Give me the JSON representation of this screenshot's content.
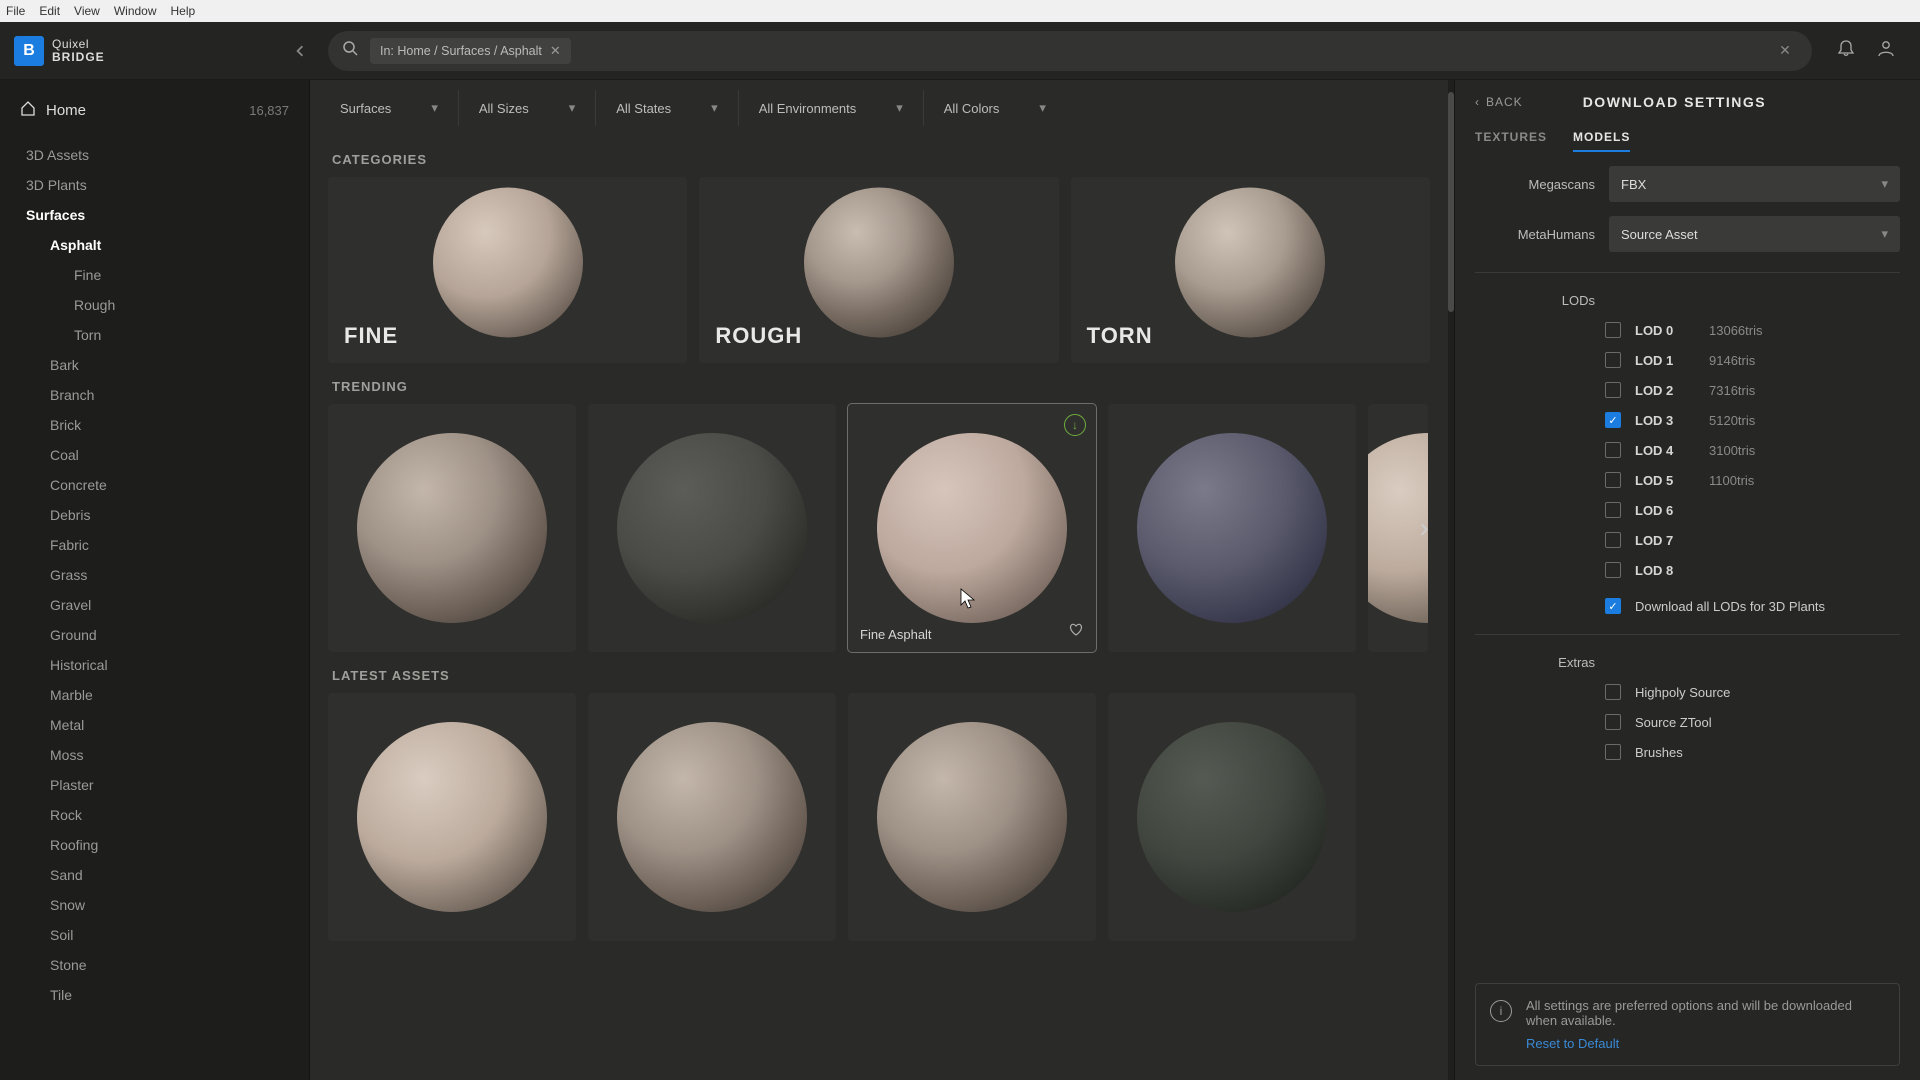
{
  "menubar": [
    "File",
    "Edit",
    "View",
    "Window",
    "Help"
  ],
  "brand": {
    "line1": "Quixel",
    "line2": "BRIDGE"
  },
  "search_chip": "In: Home / Surfaces / Asphalt",
  "home_label": "Home",
  "home_count": "16,837",
  "sidebar": {
    "top": [
      {
        "label": "3D Assets"
      },
      {
        "label": "3D Plants"
      },
      {
        "label": "Surfaces",
        "active": true,
        "children": [
          {
            "label": "Asphalt",
            "active": true,
            "children": [
              {
                "label": "Fine"
              },
              {
                "label": "Rough"
              },
              {
                "label": "Torn"
              }
            ]
          },
          {
            "label": "Bark"
          },
          {
            "label": "Branch"
          },
          {
            "label": "Brick"
          },
          {
            "label": "Coal"
          },
          {
            "label": "Concrete"
          },
          {
            "label": "Debris"
          },
          {
            "label": "Fabric"
          },
          {
            "label": "Grass"
          },
          {
            "label": "Gravel"
          },
          {
            "label": "Ground"
          },
          {
            "label": "Historical"
          },
          {
            "label": "Marble"
          },
          {
            "label": "Metal"
          },
          {
            "label": "Moss"
          },
          {
            "label": "Plaster"
          },
          {
            "label": "Rock"
          },
          {
            "label": "Roofing"
          },
          {
            "label": "Sand"
          },
          {
            "label": "Snow"
          },
          {
            "label": "Soil"
          },
          {
            "label": "Stone"
          },
          {
            "label": "Tile"
          }
        ]
      }
    ]
  },
  "filters": [
    {
      "label": "Surfaces"
    },
    {
      "label": "All Sizes"
    },
    {
      "label": "All States"
    },
    {
      "label": "All Environments"
    },
    {
      "label": "All Colors"
    }
  ],
  "sections": {
    "categories": "CATEGORIES",
    "trending": "TRENDING",
    "latest": "LATEST ASSETS"
  },
  "categories": [
    {
      "label": "FINE"
    },
    {
      "label": "ROUGH"
    },
    {
      "label": "TORN"
    }
  ],
  "trending_hover_label": "Fine Asphalt",
  "panel": {
    "back": "BACK",
    "title": "DOWNLOAD SETTINGS",
    "tabs": {
      "textures": "TEXTURES",
      "models": "MODELS"
    },
    "megascans_label": "Megascans",
    "megascans_value": "FBX",
    "metahumans_label": "MetaHumans",
    "metahumans_value": "Source Asset",
    "lods_label": "LODs",
    "lods": [
      {
        "name": "LOD 0",
        "tris": "13066tris",
        "checked": false
      },
      {
        "name": "LOD 1",
        "tris": "9146tris",
        "checked": false
      },
      {
        "name": "LOD 2",
        "tris": "7316tris",
        "checked": false
      },
      {
        "name": "LOD 3",
        "tris": "5120tris",
        "checked": true
      },
      {
        "name": "LOD 4",
        "tris": "3100tris",
        "checked": false
      },
      {
        "name": "LOD 5",
        "tris": "1100tris",
        "checked": false
      },
      {
        "name": "LOD 6",
        "tris": "",
        "checked": false
      },
      {
        "name": "LOD 7",
        "tris": "",
        "checked": false
      },
      {
        "name": "LOD 8",
        "tris": "",
        "checked": false
      }
    ],
    "dl_all_plants": "Download all LODs for 3D Plants",
    "extras_label": "Extras",
    "extras": [
      {
        "label": "Highpoly Source"
      },
      {
        "label": "Source ZTool"
      },
      {
        "label": "Brushes"
      }
    ],
    "info": "All settings are preferred options and will be downloaded when available.",
    "reset": "Reset to Default"
  }
}
